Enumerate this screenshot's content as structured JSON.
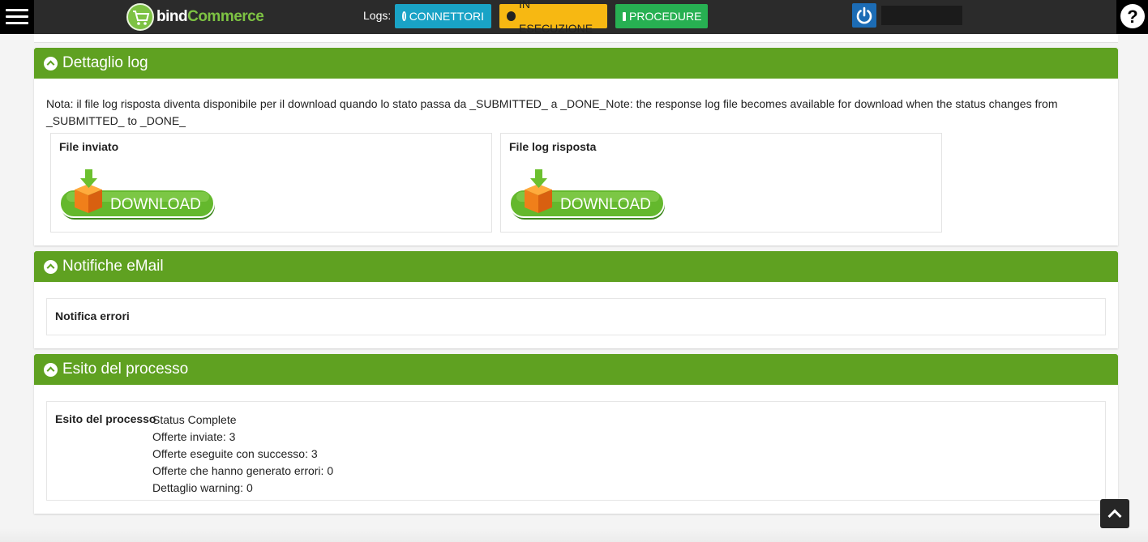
{
  "header": {
    "logo": {
      "part1": "bind",
      "part2": "Commerce"
    },
    "logs_label": "Logs:",
    "buttons": {
      "connettori": "CONNETTORI",
      "in_esecuzione": "IN ESECUZIONE",
      "procedure": "PROCEDURE"
    },
    "help": "?"
  },
  "panels": {
    "dettaglio_log": {
      "title": "Dettaglio log",
      "note": "Nota: il file log risposta diventa disponibile per il download quando lo stato passa da _SUBMITTED_ a _DONE_Note: the response log file becomes available for download when the status changes from _SUBMITTED_ to _DONE_",
      "file_inviato_label": "File inviato",
      "file_log_label": "File log risposta",
      "download_text": "DOWNLOAD"
    },
    "notifiche": {
      "title": "Notifiche eMail",
      "notifica_errori_label": "Notifica errori"
    },
    "esito": {
      "title": "Esito del processo",
      "label": "Esito del processo",
      "lines": [
        "Status Complete",
        "Offerte inviate: 3",
        "Offerte eseguite con successo: 3",
        "Offerte che hanno generato errori: 0",
        "Dettaglio warning: 0"
      ]
    }
  },
  "colors": {
    "panel_header": "#5fa121",
    "connettori_btn": "#19a3c6",
    "in_esecuzione_btn": "#f7b812",
    "procedure_btn": "#27b052",
    "power_btn": "#1c6cb5",
    "topbar": "#2b2b2b"
  },
  "icons": {
    "menu": "hamburger-icon",
    "logo": "shopping-cart-icon",
    "connettori": "arrow-circle-right-icon",
    "in_esecuzione": "arrow-circle-right-icon",
    "procedure": "calendar-icon",
    "power": "power-icon",
    "help": "question-icon",
    "panel_toggle": "chevron-up-circle-icon",
    "download": "download-box-icon",
    "scroll_top": "chevron-up-icon"
  }
}
